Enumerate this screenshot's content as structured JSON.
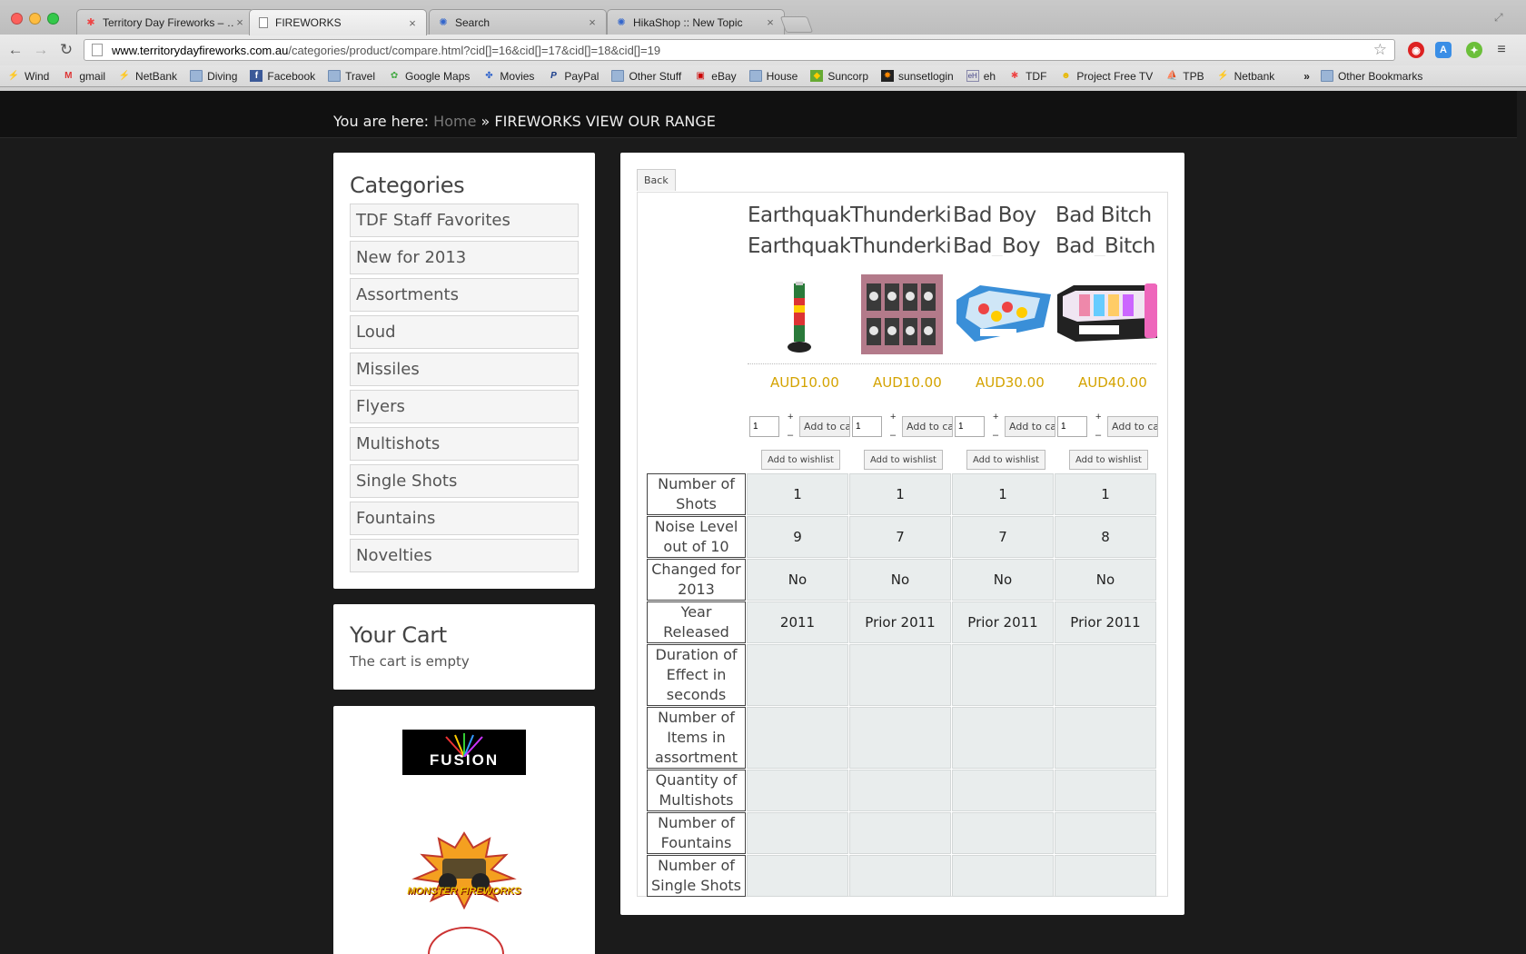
{
  "browser": {
    "tabs": [
      {
        "title": "Territory Day Fireworks – …",
        "active": false,
        "icon": "joomla-icon"
      },
      {
        "title": "FIREWORKS",
        "active": true,
        "icon": "page-icon"
      },
      {
        "title": "Search",
        "active": false,
        "icon": "hikashop-icon"
      },
      {
        "title": "HikaShop :: New Topic",
        "active": false,
        "icon": "hikashop-icon"
      }
    ],
    "url_host": "www.territorydayfireworks.com.au",
    "url_path": "/categories/product/compare.html?cid[]=16&cid[]=17&cid[]=18&cid[]=19",
    "bookmarks": [
      {
        "label": "Wind",
        "icon": "bolt-icon"
      },
      {
        "label": "gmail",
        "icon": "gmail-icon"
      },
      {
        "label": "NetBank",
        "icon": "bank-icon"
      },
      {
        "label": "Diving",
        "icon": "folder-icon"
      },
      {
        "label": "Facebook",
        "icon": "facebook-icon"
      },
      {
        "label": "Travel",
        "icon": "folder-icon"
      },
      {
        "label": "Google Maps",
        "icon": "maps-icon"
      },
      {
        "label": "Movies",
        "icon": "movies-icon"
      },
      {
        "label": "PayPal",
        "icon": "paypal-icon"
      },
      {
        "label": "Other Stuff",
        "icon": "folder-icon"
      },
      {
        "label": "eBay",
        "icon": "ebay-icon"
      },
      {
        "label": "House",
        "icon": "folder-icon"
      },
      {
        "label": "Suncorp",
        "icon": "suncorp-icon"
      },
      {
        "label": "sunsetlogin",
        "icon": "sunset-icon"
      },
      {
        "label": "eh",
        "icon": "eh-icon"
      },
      {
        "label": "TDF",
        "icon": "joomla-icon"
      },
      {
        "label": "Project Free TV",
        "icon": "tv-icon"
      },
      {
        "label": "TPB",
        "icon": "tpb-icon"
      },
      {
        "label": "Netbank",
        "icon": "bank-icon"
      }
    ],
    "overflow_chevron": "»",
    "other_bookmarks": "Other Bookmarks"
  },
  "breadcrumb": {
    "prefix": "You are here:",
    "home": "Home",
    "separator": "»",
    "current": "FIREWORKS VIEW OUR RANGE"
  },
  "categories": {
    "title": "Categories",
    "items": [
      "TDF Staff Favorites",
      "New for 2013",
      "Assortments",
      "Loud",
      "Missiles",
      "Flyers",
      "Multishots",
      "Single Shots",
      "Fountains",
      "Novelties"
    ]
  },
  "cart": {
    "title": "Your Cart",
    "status": "The cart is empty"
  },
  "brands": {
    "fusion": "FUSION",
    "monster": "MONSTER FIREWORKS"
  },
  "compare": {
    "back_label": "Back",
    "add_to_cart_label": "Add to car",
    "add_to_wishlist_label": "Add to wishlist",
    "plus": "+",
    "minus": "–",
    "products": [
      {
        "name": "Earthquake",
        "code": "Earthquake",
        "price": "AUD10.00",
        "qty": "1"
      },
      {
        "name": "Thunderking",
        "code": "Thunderking",
        "price": "AUD10.00",
        "qty": "1"
      },
      {
        "name": "Bad Boy",
        "code": "Bad_Boy",
        "price": "AUD30.00",
        "qty": "1"
      },
      {
        "name": "Bad Bitch",
        "code": "Bad_Bitch",
        "price": "AUD40.00",
        "qty": "1"
      }
    ],
    "specs": [
      {
        "label": "Number of Shots",
        "values": [
          "1",
          "1",
          "1",
          "1"
        ]
      },
      {
        "label": "Noise Level out of 10",
        "values": [
          "9",
          "7",
          "7",
          "8"
        ]
      },
      {
        "label": "Changed for 2013",
        "values": [
          "No",
          "No",
          "No",
          "No"
        ]
      },
      {
        "label": "Year Released",
        "values": [
          "2011",
          "Prior 2011",
          "Prior 2011",
          "Prior 2011"
        ]
      },
      {
        "label": "Duration of Effect in seconds",
        "values": [
          "",
          "",
          "",
          ""
        ]
      },
      {
        "label": "Number of Items in assortment",
        "values": [
          "",
          "",
          "",
          ""
        ]
      },
      {
        "label": "Quantity of Multishots",
        "values": [
          "",
          "",
          "",
          ""
        ]
      },
      {
        "label": "Number of Fountains",
        "values": [
          "",
          "",
          "",
          ""
        ]
      },
      {
        "label": "Number of Single Shots",
        "values": [
          "",
          "",
          "",
          ""
        ]
      }
    ]
  },
  "colors": {
    "price": "#d4a300",
    "page_bg": "#1b1b1b",
    "spec_cell": "#e9eded"
  }
}
